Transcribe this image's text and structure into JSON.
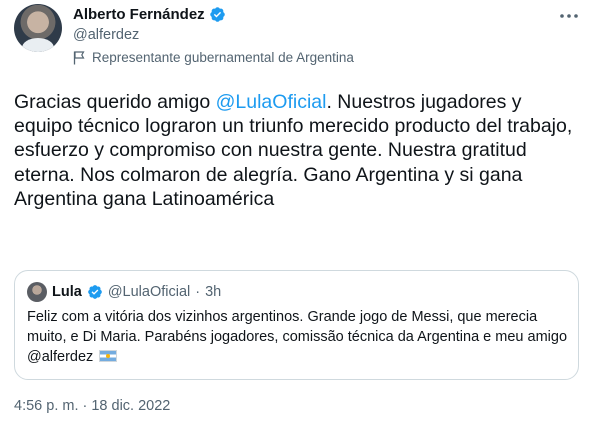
{
  "author": {
    "name": "Alberto Fernández",
    "handle": "@alferdez",
    "label": "Representante gubernamental de Argentina",
    "verified": true
  },
  "more_icon": "more-horizontal-icon",
  "tweet": {
    "text_before": "Gracias querido amigo ",
    "mention": "@LulaOficial",
    "text_after": ". Nuestros jugadores y equipo técnico lograron un triunfo merecido producto del trabajo, esfuerzo y compromiso con nuestra gente. Nuestra gratitud eterna. Nos colmaron de alegría. Gano Argentina y si gana Argentina gana Latinoamérica"
  },
  "quote": {
    "name": "Lula",
    "handle": "@LulaOficial",
    "separator": "·",
    "time": "3h",
    "text_before": "Feliz com a vitória dos vizinhos argentinos. Grande jogo de Messi, que merecia muito, e Di Maria. Parabéns jogadores, comissão técnica da Argentina e meu amigo ",
    "mention": "@alferdez",
    "flag_emoji": "argentina-flag"
  },
  "timestamp": "4:56 p. m. · 18 dic. 2022",
  "colors": {
    "accent": "#1d9bf0",
    "text": "#0f1419",
    "secondary": "#536471",
    "border": "#cfd9de"
  }
}
